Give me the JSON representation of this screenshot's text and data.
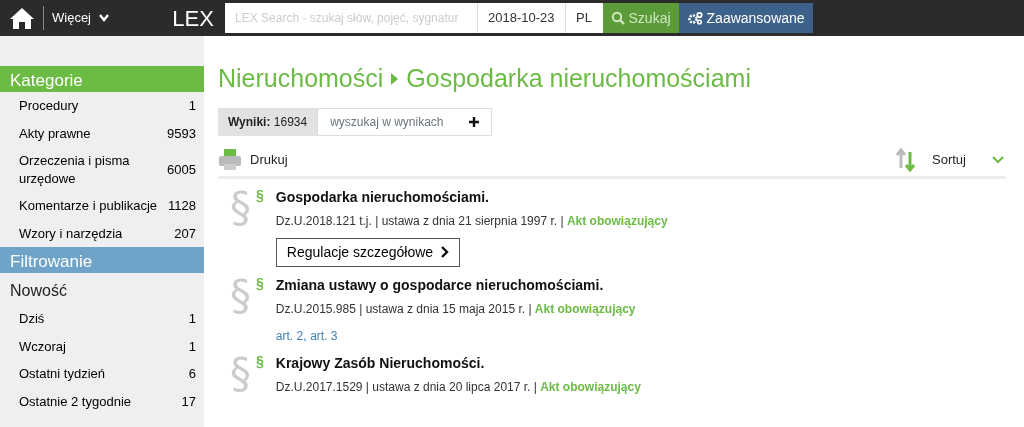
{
  "topbar": {
    "more_label": "Więcej",
    "logo": "LEX",
    "search": {
      "placeholder": "LEX Search - szukaj słów, pojęć, sygnatur"
    },
    "date": "2018-10-23",
    "language": "PL",
    "search_button": "Szukaj",
    "advanced_button": "Zaawansowane"
  },
  "sidebar": {
    "sections": [
      {
        "title": "Kategorie",
        "kind": "category",
        "groups": [
          {
            "items": [
              {
                "label": "Procedury",
                "count": "1"
              },
              {
                "label": "Akty prawne",
                "count": "9593"
              },
              {
                "label": "Orzeczenia i pisma urzędowe",
                "count": "6005"
              },
              {
                "label": "Komentarze i publikacje",
                "count": "1128"
              },
              {
                "label": "Wzory i narzędzia",
                "count": "207"
              }
            ]
          }
        ]
      },
      {
        "title": "Filtrowanie",
        "kind": "filter",
        "groups": [
          {
            "title": "Nowość",
            "items": [
              {
                "label": "Dziś",
                "count": "1"
              },
              {
                "label": "Wczoraj",
                "count": "1"
              },
              {
                "label": "Ostatni tydzień",
                "count": "6"
              },
              {
                "label": "Ostatnie 2 tygodnie",
                "count": "17"
              }
            ]
          }
        ]
      }
    ]
  },
  "breadcrumb": [
    "Nieruchomości",
    "Gospodarka nieruchomościami"
  ],
  "results": {
    "label": "Wyniki:",
    "count": "16934",
    "filter_placeholder": "wyszukaj w wynikach"
  },
  "toolbar": {
    "print": "Drukuj",
    "sort": "Sortuj"
  },
  "documents": [
    {
      "title": "Gospodarka nieruchomościami.",
      "source": "Dz.U.2018.121 t.j. | ustawa z dnia 21 sierpnia 1997 r. |",
      "status": "Akt obowiązujący",
      "icon_large": "§",
      "icon_small": "§",
      "button": "Regulacje szczegółowe"
    },
    {
      "title": "Zmiana ustawy o gospodarce nieruchomościami.",
      "source": "Dz.U.2015.985 | ustawa z dnia 15 maja 2015 r. |",
      "status": "Akt obowiązujący",
      "icon_large": "§",
      "icon_small": "§",
      "links": [
        "art. 2",
        "art. 3"
      ],
      "link_separators": [
        ","
      ]
    },
    {
      "title": "Krajowy Zasób Nieruchomości.",
      "source": "Dz.U.2017.1529 | ustawa z dnia 20 lipca 2017 r. |",
      "status": "Akt obowiązujący",
      "icon_large": "§",
      "icon_small": "§"
    }
  ]
}
